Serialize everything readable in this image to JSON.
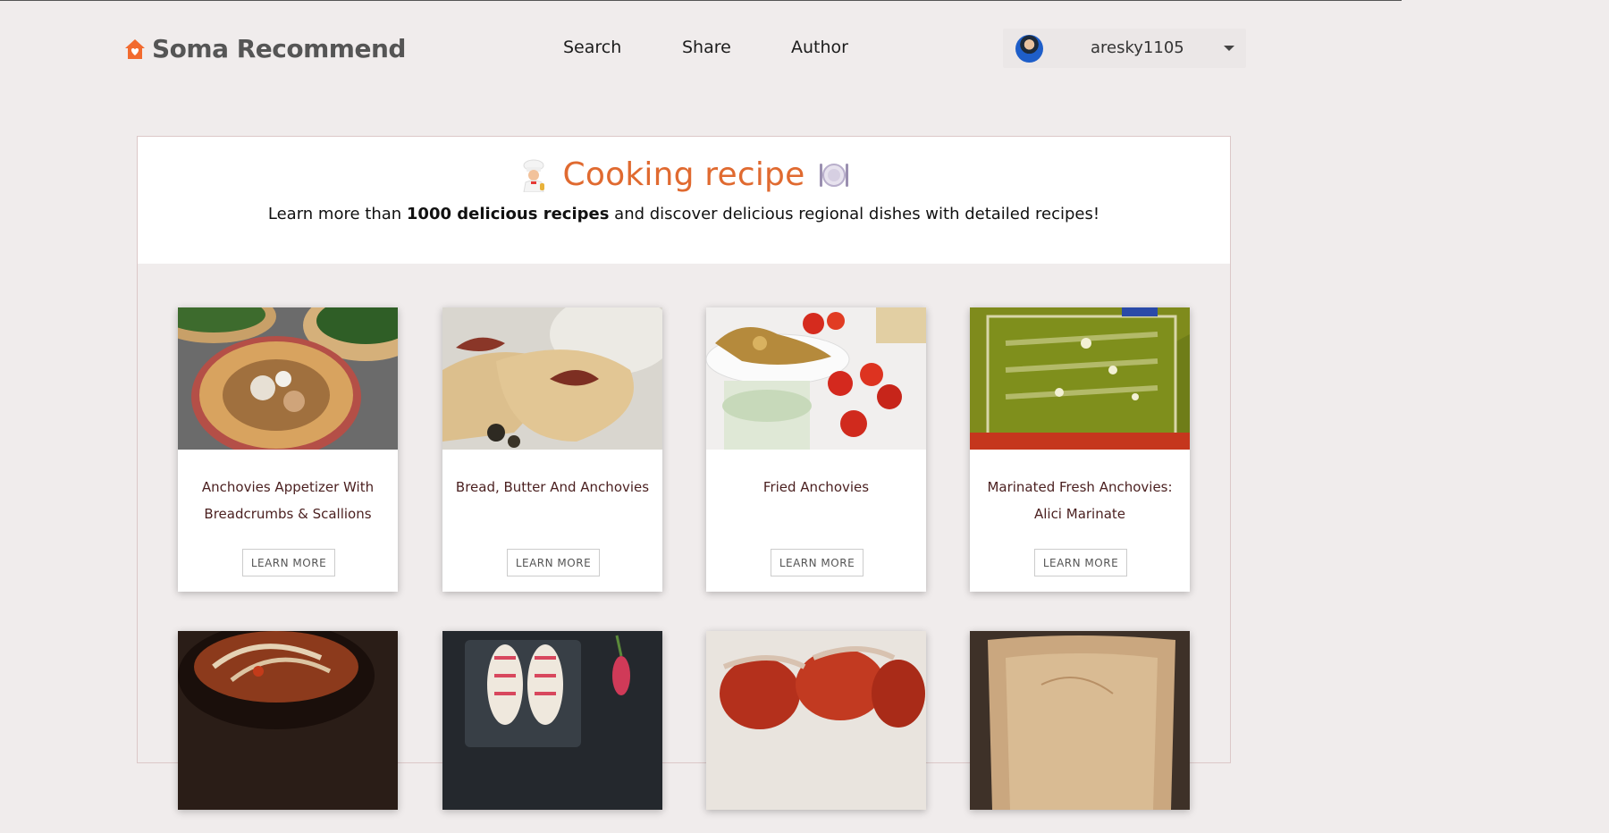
{
  "header": {
    "brand": "Soma Recommend",
    "nav": [
      {
        "label": "Search"
      },
      {
        "label": "Share"
      },
      {
        "label": "Author"
      }
    ],
    "user": {
      "name": "aresky1105"
    }
  },
  "hero": {
    "title": "Cooking recipe",
    "subtitle_before": "Learn more than ",
    "subtitle_bold": "1000 delicious recipes",
    "subtitle_after": " and discover delicious regional dishes with detailed recipes!"
  },
  "recipes": [
    {
      "name": "Anchovies Appetizer With Breadcrumbs & Scallions",
      "button": "LEARN MORE"
    },
    {
      "name": "Bread, Butter And Anchovies",
      "button": "LEARN MORE"
    },
    {
      "name": "Fried Anchovies",
      "button": "LEARN MORE"
    },
    {
      "name": "Marinated Fresh Anchovies: Alici Marinate",
      "button": "LEARN MORE"
    }
  ],
  "colors": {
    "accent": "#e06a30",
    "background": "#f0ecec",
    "card_title": "#4a1f1f"
  },
  "icons": [
    "home-heart-icon",
    "chef-icon",
    "plate-icon",
    "caret-down-icon"
  ]
}
